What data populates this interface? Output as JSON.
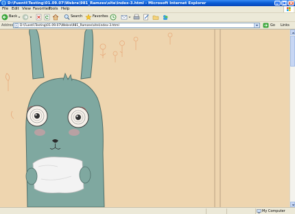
{
  "window": {
    "title": "D:\\Fuenti\\Testing\\01.09.07\\Webra\\981_Ramzes\\site\\index-3.html - Microsoft Internet Explorer"
  },
  "menu": [
    "File",
    "Edit",
    "View",
    "Favorites",
    "Tools",
    "Help"
  ],
  "toolbar": {
    "back_label": "Back",
    "search_label": "Search",
    "favorites_label": "Favorites"
  },
  "address": {
    "label": "Address",
    "value": "D:\\Fuenti\\Testing\\01.09.07\\Webra\\981_Ramzes\\site\\index-3.html",
    "go_label": "Go",
    "links_label": "Links"
  },
  "status": {
    "zone": "My Computer"
  },
  "colors": {
    "page_background": "#f0d9b5",
    "rabbit_body": "#7fa8a0",
    "panel_line": "#b89f80"
  }
}
